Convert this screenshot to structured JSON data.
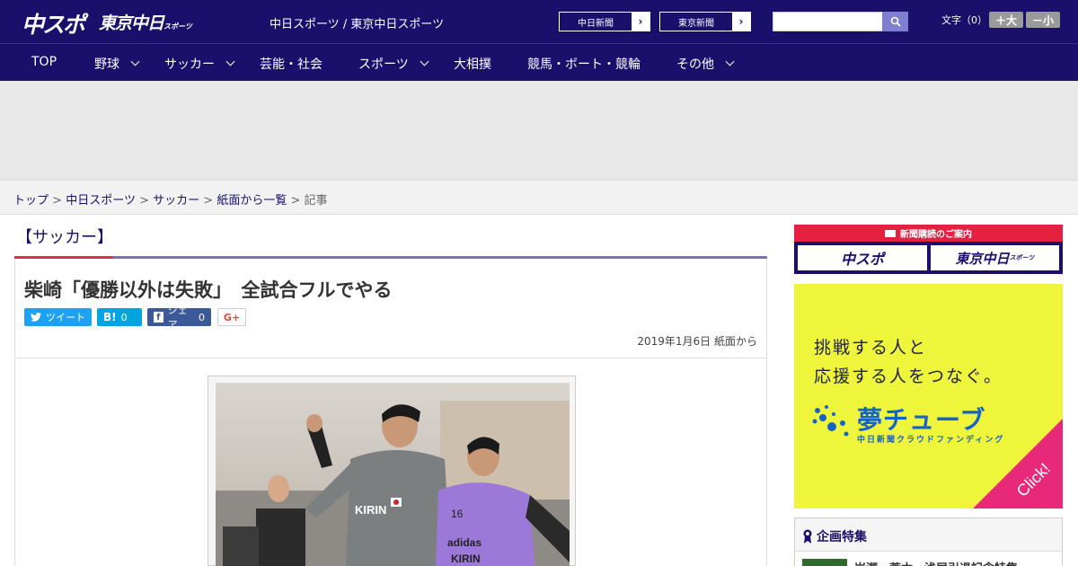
{
  "header": {
    "logo_main": "中スポ",
    "logo_tokyo": "東京中日",
    "logo_tokyo_small": "スポーツ",
    "site_name": "中日スポーツ / 東京中日スポーツ",
    "ext_links": [
      {
        "label": "中日新聞"
      },
      {
        "label": "東京新聞"
      }
    ],
    "search_placeholder": "",
    "font_size_label": "文字（0）",
    "font_bigger": "＋大",
    "font_smaller": "－小"
  },
  "nav": {
    "items": [
      {
        "label": "TOP",
        "dropdown": false
      },
      {
        "label": "野球",
        "dropdown": true
      },
      {
        "label": "サッカー",
        "dropdown": true
      },
      {
        "label": "芸能・社会",
        "dropdown": false
      },
      {
        "label": "スポーツ",
        "dropdown": true
      },
      {
        "label": "大相撲",
        "dropdown": false
      },
      {
        "label": "競馬・ボート・競輪",
        "dropdown": false
      },
      {
        "label": "その他",
        "dropdown": true
      }
    ]
  },
  "breadcrumb": {
    "items": [
      "トップ",
      "中日スポーツ",
      "サッカー",
      "紙面から一覧"
    ],
    "current": "記事",
    "separator": ">"
  },
  "article": {
    "section": "【サッカー】",
    "headline": "柴崎「優勝以外は失敗」　全試合フルでやる",
    "share": {
      "tweet": "ツイート",
      "hatena_count": "0",
      "hatena_icon": "B!",
      "facebook": "シェア",
      "facebook_count": "0",
      "gplus": "G+"
    },
    "date_line": "2019年1月6日 紙面から",
    "photo_label_jersey": "KIRIN",
    "photo_bib_number": "16",
    "photo_bib_brand": "adidas",
    "photo_bib_sponsor": "KIRIN"
  },
  "sidebar": {
    "subscribe_header": "新聞購読のご案内",
    "subscribe_logo1": "中スポ",
    "subscribe_logo2": "東京中日",
    "subscribe_logo2_small": "スポーツ",
    "yume_line1": "挑戦する人と",
    "yume_line2": "応援する人をつなぐ。",
    "yume_logo": "夢チューブ",
    "yume_sub": "中日新聞クラウドファンディング",
    "yume_click": "Click!",
    "feature_title": "企画特集",
    "feature_item": "岩瀬・荒木・浅尾引退記念特集"
  },
  "colors": {
    "brand_navy": "#1a0f6b",
    "accent_red": "#e6213f",
    "twitter": "#1da1f2",
    "hatena": "#00a4de",
    "facebook": "#3b5998",
    "yume_bg": "#eef53a",
    "yume_blue": "#1563c8"
  }
}
